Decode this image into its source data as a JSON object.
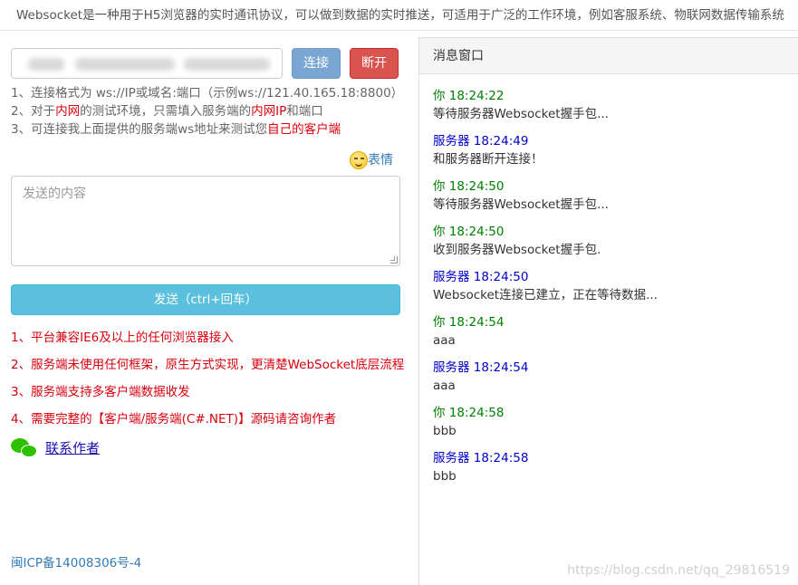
{
  "intro_text": "Websocket是一种用于H5浏览器的实时通讯协议，可以做到数据的实时推送，可适用于广泛的工作环境，例如客服系统、物联网数据传输系统",
  "connect_label": "连接",
  "disconnect_label": "断开",
  "notes": {
    "line1": "1、连接格式为 ws://IP或域名:端口（示例ws://121.40.165.18:8800）",
    "line2_a": "2、对于",
    "line2_b": "内网",
    "line2_c": "的测试环境，只需填入服务端的",
    "line2_d": "内网IP",
    "line2_e": "和端口",
    "line3_a": "3、可连接我上面提供的服务端ws地址来测试您",
    "line3_b": "自己的客户端"
  },
  "emoji_label": "表情",
  "message_placeholder": "发送的内容",
  "send_label": "发送（ctrl+回车）",
  "features": [
    "1、平台兼容IE6及以上的任何浏览器接入",
    "2、服务端未使用任何框架，原生方式实现，更清楚WebSocket底层流程",
    "3、服务端支持多客户端数据收发",
    "4、需要完整的【客户端/服务端(C#.NET)】源码请咨询作者"
  ],
  "contact_label": "联系作者",
  "icp_label": "闽ICP备14008306号-4",
  "panel_title": "消息窗口",
  "messages": [
    {
      "who": "你",
      "time": "18:24:22",
      "text": "等待服务器Websocket握手包..."
    },
    {
      "who": "服务器",
      "time": "18:24:49",
      "text": "和服务器断开连接！"
    },
    {
      "who": "你",
      "time": "18:24:50",
      "text": "等待服务器Websocket握手包..."
    },
    {
      "who": "你",
      "time": "18:24:50",
      "text": "收到服务器Websocket握手包."
    },
    {
      "who": "服务器",
      "time": "18:24:50",
      "text": "Websocket连接已建立，正在等待数据..."
    },
    {
      "who": "你",
      "time": "18:24:54",
      "text": "aaa"
    },
    {
      "who": "服务器",
      "time": "18:24:54",
      "text": "aaa"
    },
    {
      "who": "你",
      "time": "18:24:58",
      "text": "bbb"
    },
    {
      "who": "服务器",
      "time": "18:24:58",
      "text": "bbb"
    }
  ],
  "watermark": "https://blog.csdn.net/qq_29816519",
  "colors": {
    "you": "#008000",
    "server": "#0000cd",
    "accent_red": "#d9000c",
    "send_button": "#5bc0de",
    "connect_button": "#7aa6d3",
    "disconnect_button": "#d9534f"
  }
}
